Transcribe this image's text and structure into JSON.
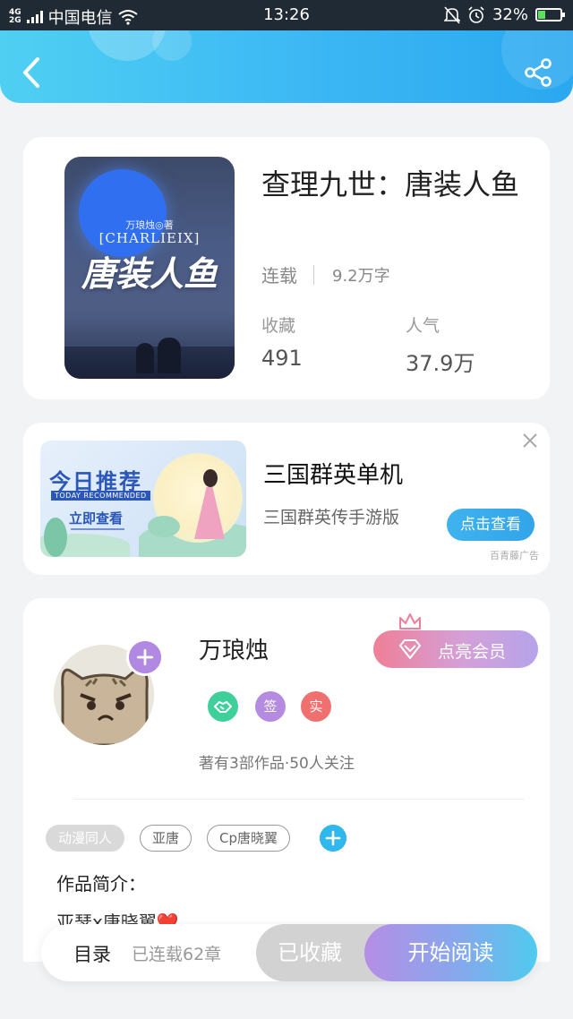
{
  "status_bar": {
    "network_top": "4G",
    "network_bottom": "2G",
    "carrier": "中国电信",
    "time": "13:26",
    "battery": "32%",
    "battery_level": 0.32
  },
  "book": {
    "title": "查理九世：唐装人鱼",
    "status": "连载",
    "word_count": "9.2万字",
    "collect_label": "收藏",
    "collect_value": "491",
    "popularity_label": "人气",
    "popularity_value": "37.9万",
    "cover": {
      "author_line": "万琅烛◎著",
      "english_title": "[CHARLIEIX]",
      "title": "唐装人鱼"
    }
  },
  "ad": {
    "image_title": "今日推荐",
    "image_subtitle": "TODAY RECOMMENDED",
    "image_cta": "立即查看",
    "title": "三国群英单机",
    "subtitle": "三国群英传手游版",
    "button": "点击查看",
    "tag": "百青藤广告"
  },
  "author": {
    "name": "万琅烛",
    "vip_button": "点亮会员",
    "badges": [
      {
        "label": "",
        "color": "#3ecf9a",
        "icon": "handshake-icon"
      },
      {
        "label": "签",
        "color": "#b48be0"
      },
      {
        "label": "实",
        "color": "#f07070"
      }
    ],
    "info": "著有3部作品·50人关注",
    "tags": [
      {
        "label": "动漫同人",
        "style": "solid"
      },
      {
        "label": "亚唐",
        "style": "outline"
      },
      {
        "label": "Cp唐晓翼",
        "style": "outline"
      }
    ],
    "intro_label": "作品简介：",
    "intro_text": "亚瑟x唐晓翼❤️"
  },
  "bottom_bar": {
    "toc_label": "目录",
    "toc_count": "已连载62章",
    "collected_button": "已收藏",
    "read_button": "开始阅读"
  },
  "colors": {
    "header_start": "#4fd0f2",
    "header_end": "#2aa8f0",
    "accent_blue": "#3fb3ee",
    "accent_purple": "#b58ee6"
  }
}
